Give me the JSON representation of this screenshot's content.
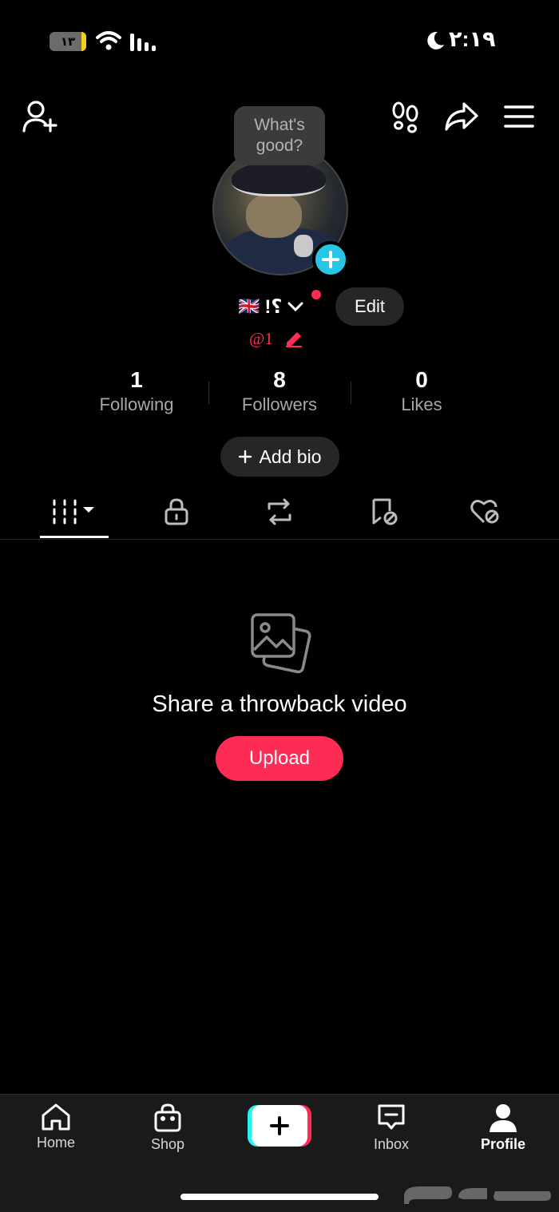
{
  "status_bar": {
    "battery_level": "١٣",
    "battery_fraction": 0.13,
    "time": "٢:١٩",
    "icons": [
      "battery-icon",
      "wifi-icon",
      "signal-icon",
      "moon-icon"
    ]
  },
  "header": {
    "icons": [
      "add-friend-icon",
      "footprints-icon",
      "share-icon",
      "menu-icon"
    ]
  },
  "profile": {
    "bubble_text": "What's good?",
    "display_name": "!؟",
    "flag": "🇬🇧",
    "handle": "@1",
    "edit_label": "Edit",
    "add_bio_label": "Add bio",
    "stats": [
      {
        "value": "1",
        "label": "Following"
      },
      {
        "value": "8",
        "label": "Followers"
      },
      {
        "value": "0",
        "label": "Likes"
      }
    ]
  },
  "tabs": [
    "videos-grid-icon",
    "private-lock-icon",
    "repost-icon",
    "favorites-hidden-icon",
    "liked-hidden-icon"
  ],
  "empty_state": {
    "title": "Share a throwback video",
    "button_label": "Upload"
  },
  "bottom_nav": {
    "items": [
      {
        "label": "Home",
        "icon": "home-icon"
      },
      {
        "label": "Shop",
        "icon": "shop-bag-icon"
      },
      {
        "label": "Inbox",
        "icon": "inbox-icon"
      },
      {
        "label": "Profile",
        "icon": "profile-icon"
      }
    ],
    "create_icon": "plus-icon"
  },
  "colors": {
    "accent": "#fe2c55",
    "cyan": "#25f4ee",
    "avatar_add": "#27c6e6",
    "background": "#000000"
  }
}
